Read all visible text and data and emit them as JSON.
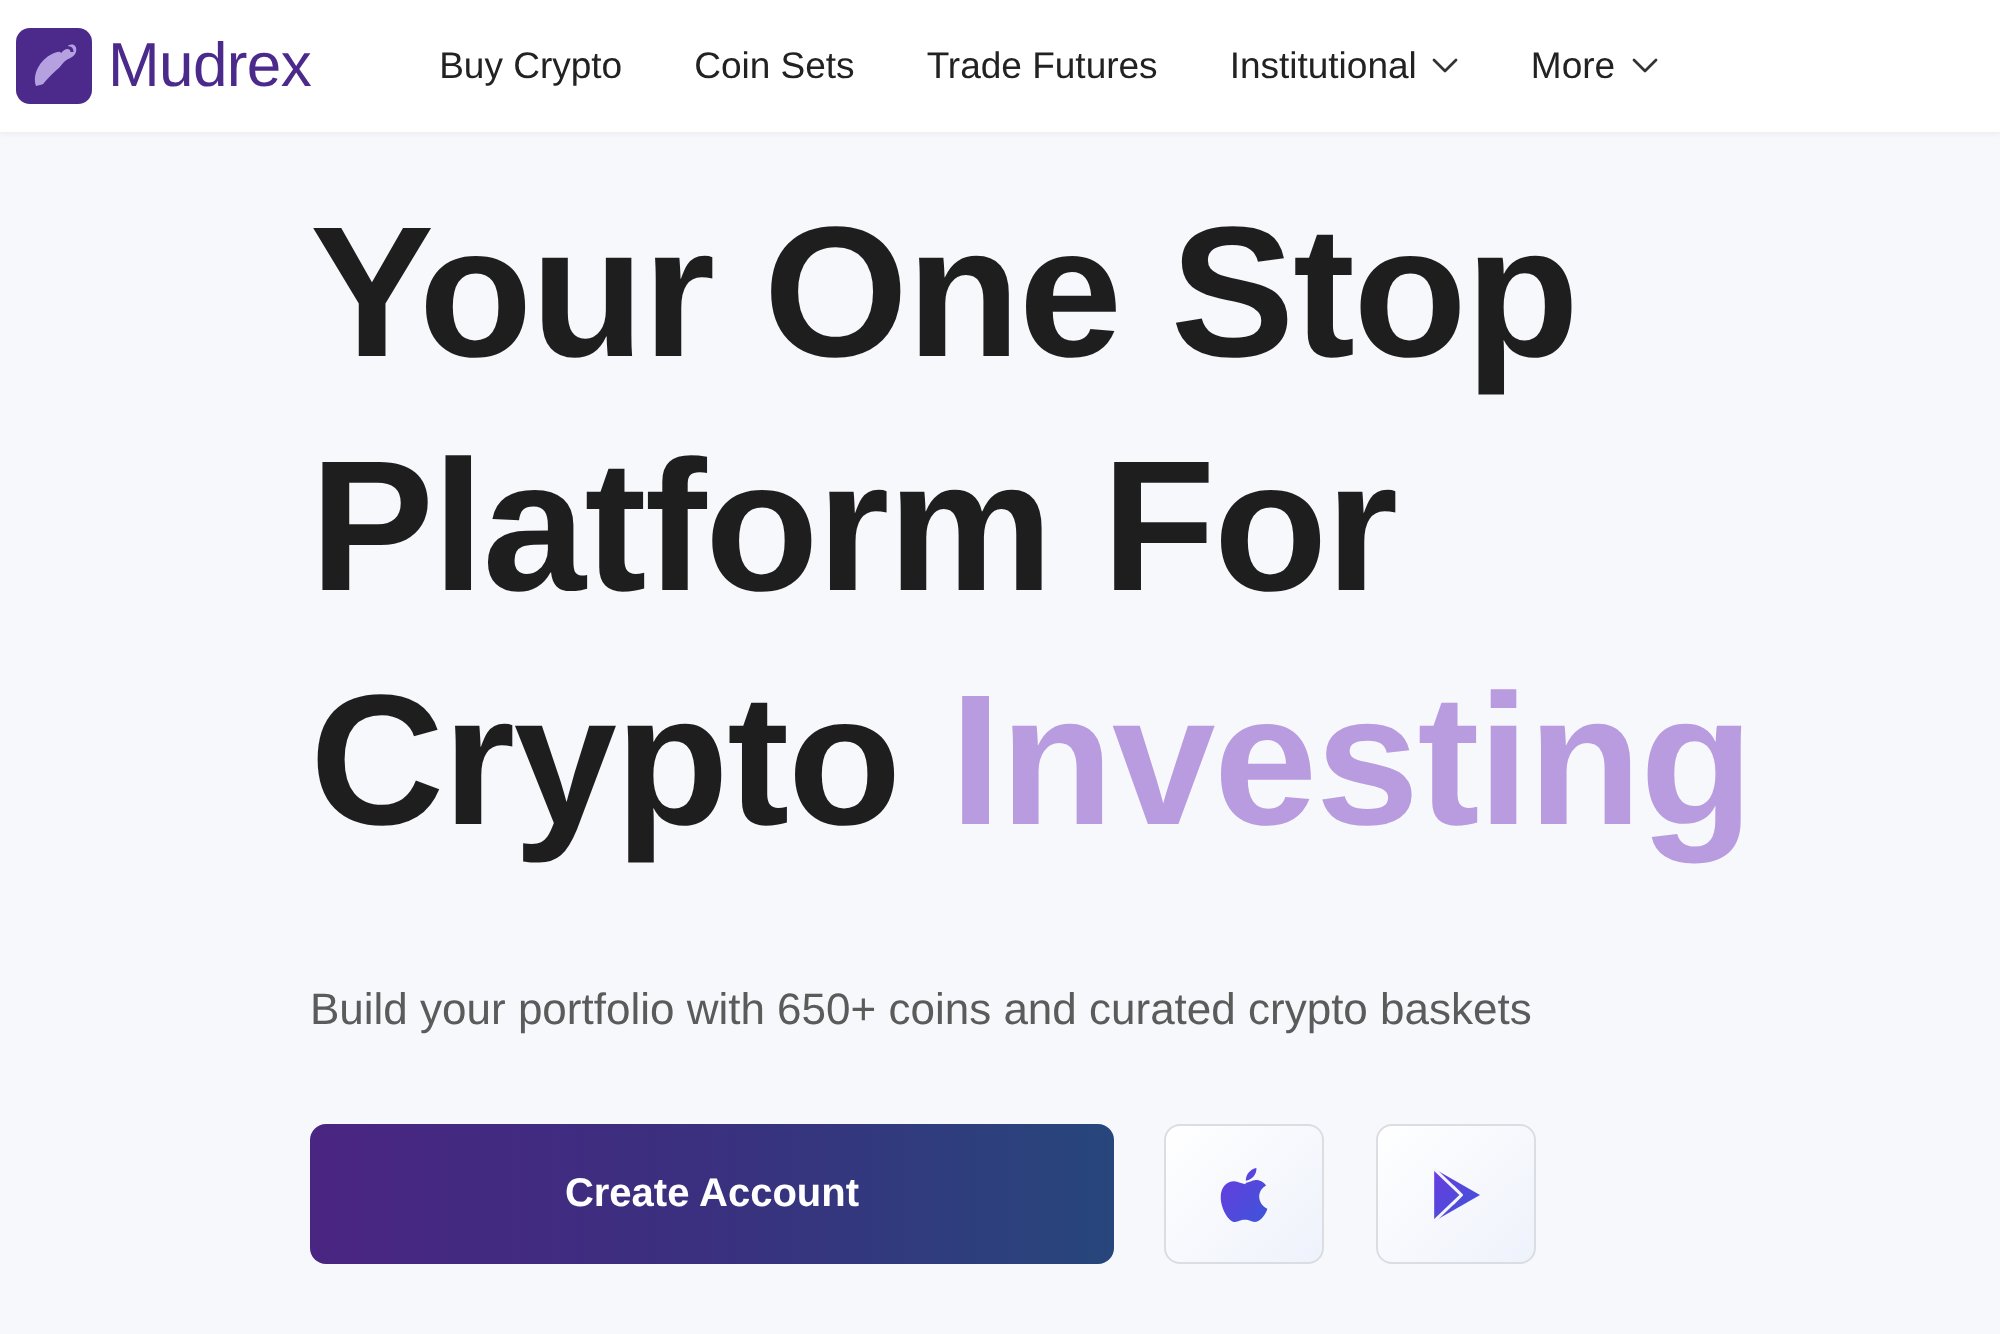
{
  "header": {
    "logo": {
      "text": "Mudrex"
    },
    "nav": [
      {
        "label": "Buy Crypto",
        "dropdown": false
      },
      {
        "label": "Coin Sets",
        "dropdown": false
      },
      {
        "label": "Trade Futures",
        "dropdown": false
      },
      {
        "label": "Institutional",
        "dropdown": true
      },
      {
        "label": "More",
        "dropdown": true
      }
    ]
  },
  "hero": {
    "headline": [
      [
        {
          "text": "Your One Stop",
          "highlight": false
        }
      ],
      [
        {
          "text": "Platform For",
          "highlight": false
        }
      ],
      [
        {
          "text": "Crypto",
          "highlight": false
        },
        {
          "text": "Investing",
          "highlight": true
        }
      ]
    ],
    "subtitle": "Build your portfolio with 650+ coins and curated crypto baskets",
    "primary_button": {
      "label": "Create Account"
    },
    "app_buttons": [
      {
        "kind": "apple"
      },
      {
        "kind": "play"
      }
    ]
  }
}
